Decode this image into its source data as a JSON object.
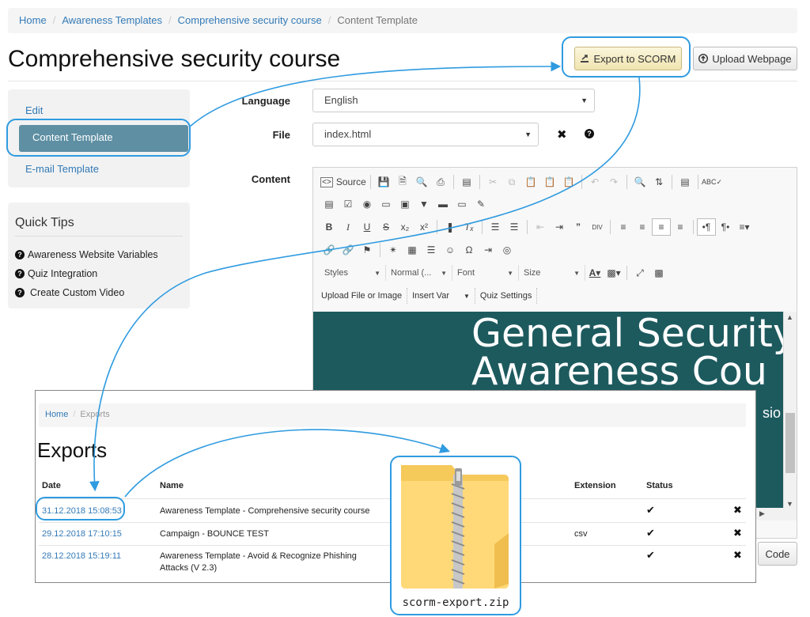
{
  "breadcrumb": {
    "items": [
      "Home",
      "Awareness Templates",
      "Comprehensive security course"
    ],
    "current": "Content Template"
  },
  "page": {
    "title": "Comprehensive security course"
  },
  "actions": {
    "export_label": "Export to SCORM",
    "upload_label": "Upload Webpage"
  },
  "nav": {
    "items": [
      {
        "label": "Edit"
      },
      {
        "label": "Content Template"
      },
      {
        "label": "E-mail Template"
      }
    ]
  },
  "quick_tips": {
    "title": "Quick Tips",
    "items": [
      "Awareness Website Variables",
      "Quiz Integration",
      "Create Custom Video"
    ]
  },
  "form": {
    "language_label": "Language",
    "language_value": "English",
    "file_label": "File",
    "file_value": "index.html",
    "content_label": "Content"
  },
  "editor": {
    "source_label": "Source",
    "combos": [
      "Styles",
      "Normal (...",
      "Font",
      "Size"
    ],
    "text_buttons": [
      "Upload File or Image",
      "Insert Var",
      "Quiz Settings"
    ],
    "preview_line1": "General Security",
    "preview_line2": "Awareness Cou",
    "preview_sub": "sio",
    "code_button": "Code"
  },
  "exports": {
    "breadcrumb_home": "Home",
    "breadcrumb_current": "Exports",
    "title": "Exports",
    "columns": {
      "date": "Date",
      "name": "Name",
      "extension": "Extension",
      "status": "Status"
    },
    "rows": [
      {
        "date": "31.12.2018 15:08:53",
        "name": "Awareness Template - Comprehensive security course",
        "extension": ""
      },
      {
        "date": "29.12.2018 17:10:15",
        "name": "Campaign - BOUNCE TEST",
        "extension": "csv"
      },
      {
        "date": "28.12.2018 15:19:11",
        "name": "Awareness Template - Avoid & Recognize Phishing Attacks (V 2.3)",
        "extension": ""
      }
    ]
  },
  "zip": {
    "filename": "scorm-export.zip"
  },
  "colors": {
    "accent": "#2f9be0",
    "link": "#337ab7",
    "nav_active": "#5e8fa3",
    "preview_bg": "#1d5a5e"
  }
}
